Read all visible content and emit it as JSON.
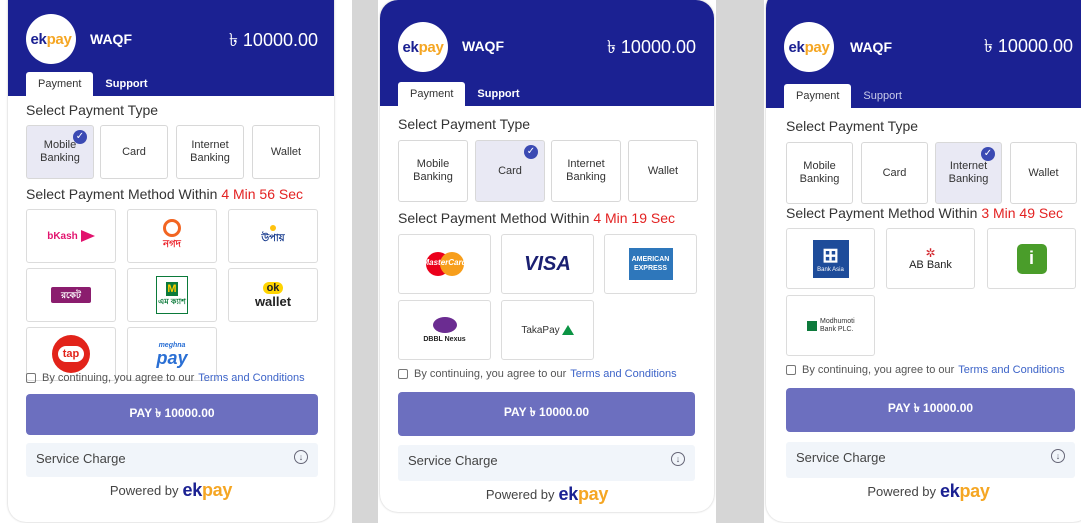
{
  "common": {
    "logo_ek": "ek",
    "logo_pay": "pay",
    "merchant": "WAQF",
    "amount": "৳ 10000.00",
    "tab_payment": "Payment",
    "tab_support": "Support",
    "select_type_title": "Select Payment Type",
    "payment_types": [
      "Mobile Banking",
      "Card",
      "Internet Banking",
      "Wallet"
    ],
    "select_method_prefix": "Select Payment Method Within",
    "terms_text": "By continuing, you agree to our",
    "terms_link": "Terms and Conditions",
    "pay_button": "PAY ৳ 10000.00",
    "service_charge": "Service Charge",
    "powered_by": "Powered by",
    "colors": {
      "header": "#1b2192",
      "pay_button": "#6c6fbf",
      "timer": "#e32222",
      "link": "#3c63c8"
    }
  },
  "panels": [
    {
      "selected_type": "Mobile Banking",
      "timer": "4 Min 56 Sec",
      "methods": [
        "bKash",
        "Nagad",
        "Upay",
        "Rocket",
        "mCash",
        "OK Wallet",
        "tap",
        "meghna pay"
      ]
    },
    {
      "selected_type": "Card",
      "timer": "4 Min 19 Sec",
      "methods": [
        "MasterCard",
        "VISA",
        "AMERICAN EXPRESS",
        "DBBL Nexus",
        "TakaPay"
      ]
    },
    {
      "selected_type": "Internet Banking",
      "timer": "3 Min 49 Sec",
      "methods": [
        "Bank Asia",
        "AB Bank",
        "Islami Bank",
        "Modhumoti Bank PLC."
      ]
    }
  ],
  "logo_text": {
    "bkash": "bKash",
    "nagad": "নগদ",
    "upay": "উপায়",
    "rocket": "রকেট",
    "mcash": "এম ক্যাশ",
    "okwallet_ok": "ok",
    "okwallet_w": "wallet",
    "tap": "tap",
    "meghna_small": "meghna",
    "meghna_big": "pay",
    "mastercard": "MasterCard",
    "visa": "VISA",
    "amex": "AMERICAN EXPRESS",
    "dbbl": "DBBL Nexus",
    "takapay": "TakaPay",
    "bankasia": "Bank Asia",
    "abbank": "AB Bank",
    "islami": "i",
    "modhumoti": "Modhumoti Bank PLC."
  }
}
